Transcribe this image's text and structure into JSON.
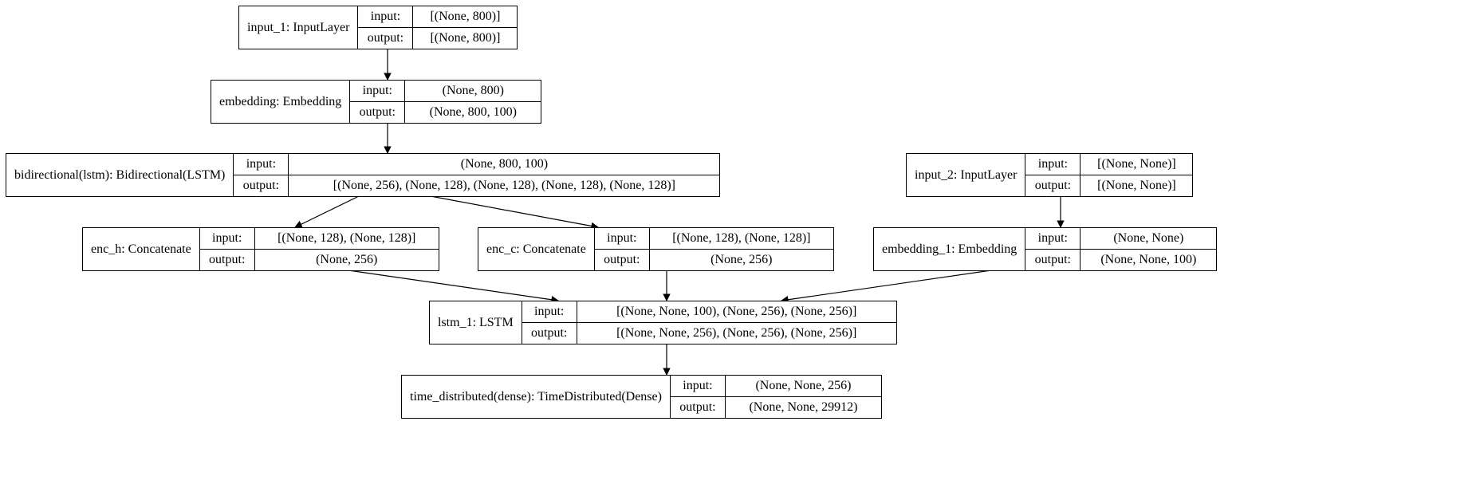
{
  "labels": {
    "input": "input:",
    "output": "output:"
  },
  "nodes": {
    "input_1": {
      "name": "input_1: InputLayer",
      "in": "[(None, 800)]",
      "out": "[(None, 800)]"
    },
    "embedding": {
      "name": "embedding: Embedding",
      "in": "(None, 800)",
      "out": "(None, 800, 100)"
    },
    "bilstm": {
      "name": "bidirectional(lstm): Bidirectional(LSTM)",
      "in": "(None, 800, 100)",
      "out": "[(None, 256), (None, 128), (None, 128), (None, 128), (None, 128)]"
    },
    "input_2": {
      "name": "input_2: InputLayer",
      "in": "[(None, None)]",
      "out": "[(None, None)]"
    },
    "enc_h": {
      "name": "enc_h: Concatenate",
      "in": "[(None, 128), (None, 128)]",
      "out": "(None, 256)"
    },
    "enc_c": {
      "name": "enc_c: Concatenate",
      "in": "[(None, 128), (None, 128)]",
      "out": "(None, 256)"
    },
    "embedding_1": {
      "name": "embedding_1: Embedding",
      "in": "(None, None)",
      "out": "(None, None, 100)"
    },
    "lstm_1": {
      "name": "lstm_1: LSTM",
      "in": "[(None, None, 100), (None, 256), (None, 256)]",
      "out": "[(None, None, 256), (None, 256), (None, 256)]"
    },
    "time_dist": {
      "name": "time_distributed(dense): TimeDistributed(Dense)",
      "in": "(None, None, 256)",
      "out": "(None, None, 29912)"
    }
  }
}
